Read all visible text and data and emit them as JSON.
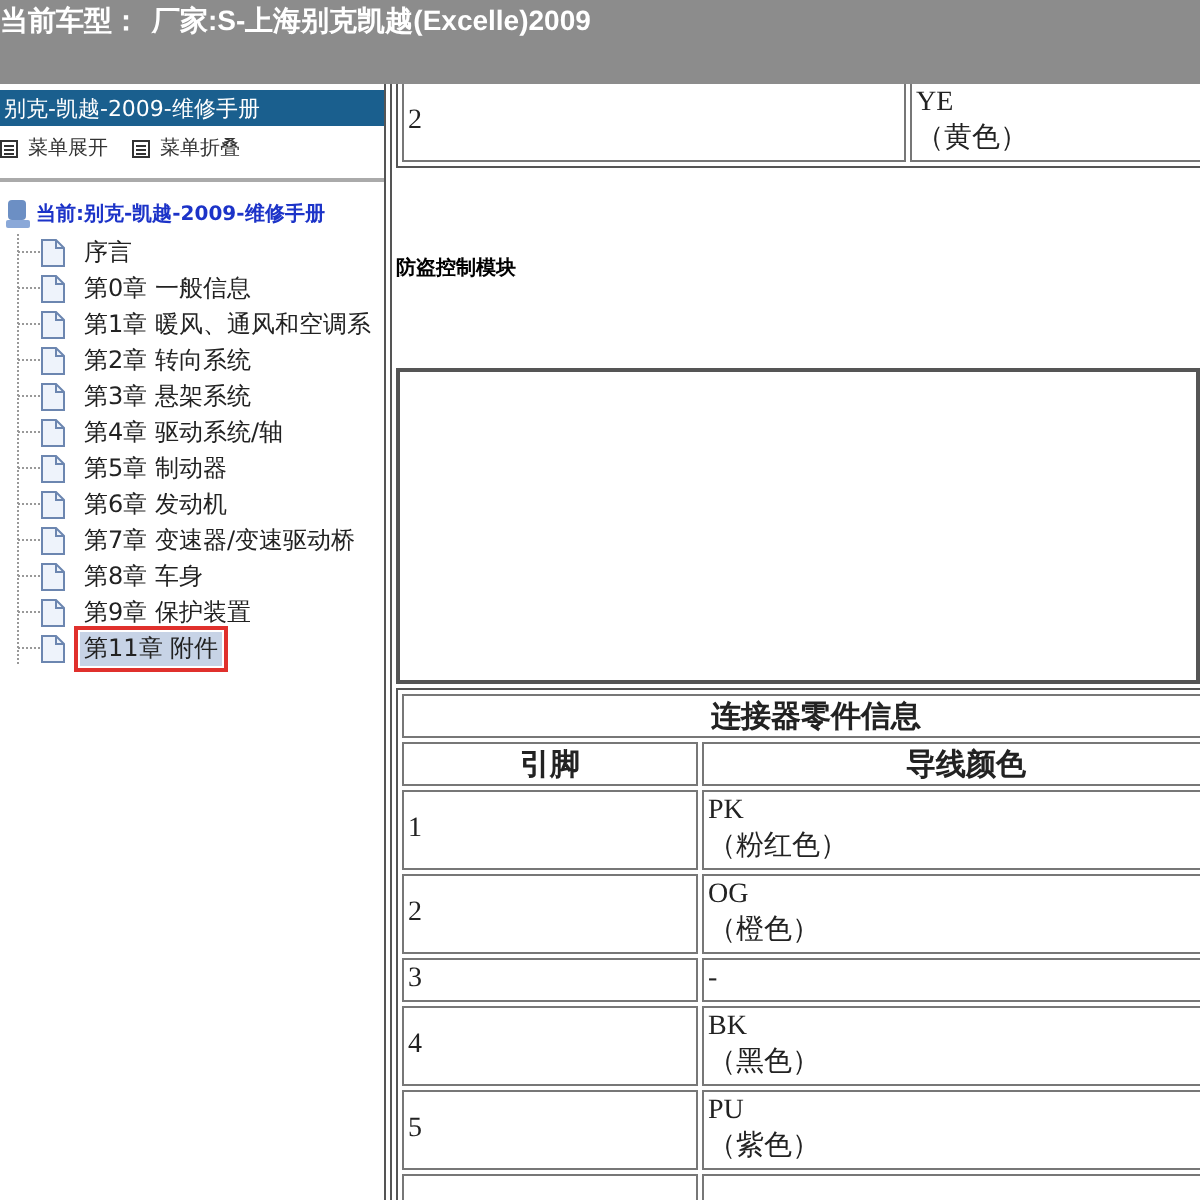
{
  "title_bar": {
    "label": "当前车型：",
    "value": "厂家:S-上海别克凯越(Excelle)2009"
  },
  "sidebar": {
    "header": "别克-凯越-2009-维修手册",
    "menu": [
      {
        "label": "菜单展开"
      },
      {
        "label": "菜单折叠"
      }
    ],
    "root": "当前:别克-凯越-2009-维修手册",
    "items": [
      {
        "label": "序言",
        "selected": false,
        "outlined": false
      },
      {
        "label": "第0章 一般信息",
        "selected": false,
        "outlined": false
      },
      {
        "label": "第1章 暖风、通风和空调系",
        "selected": false,
        "outlined": false
      },
      {
        "label": "第2章 转向系统",
        "selected": false,
        "outlined": false
      },
      {
        "label": "第3章 悬架系统",
        "selected": false,
        "outlined": false
      },
      {
        "label": "第4章 驱动系统/轴",
        "selected": false,
        "outlined": false
      },
      {
        "label": "第5章 制动器",
        "selected": false,
        "outlined": false
      },
      {
        "label": "第6章 发动机",
        "selected": false,
        "outlined": false
      },
      {
        "label": "第7章 变速器/变速驱动桥",
        "selected": false,
        "outlined": false
      },
      {
        "label": "第8章 车身",
        "selected": false,
        "outlined": false
      },
      {
        "label": "第9章 保护装置",
        "selected": false,
        "outlined": false
      },
      {
        "label": "第11章 附件",
        "selected": true,
        "outlined": true
      }
    ]
  },
  "content": {
    "top_row": {
      "pin": "2",
      "code": "YE",
      "color_name": "（黄色）"
    },
    "module_name": "防盗控制模块",
    "table": {
      "title": "连接器零件信息",
      "columns": [
        "引脚",
        "导线颜色"
      ],
      "rows": [
        {
          "pin": "1",
          "code": "PK",
          "color_name": "（粉红色）"
        },
        {
          "pin": "2",
          "code": "OG",
          "color_name": "（橙色）"
        },
        {
          "pin": "3",
          "code": "-"
        },
        {
          "pin": "4",
          "code": "BK",
          "color_name": "（黑色）"
        },
        {
          "pin": "5",
          "code": "PU",
          "color_name": "（紫色）"
        }
      ]
    }
  }
}
